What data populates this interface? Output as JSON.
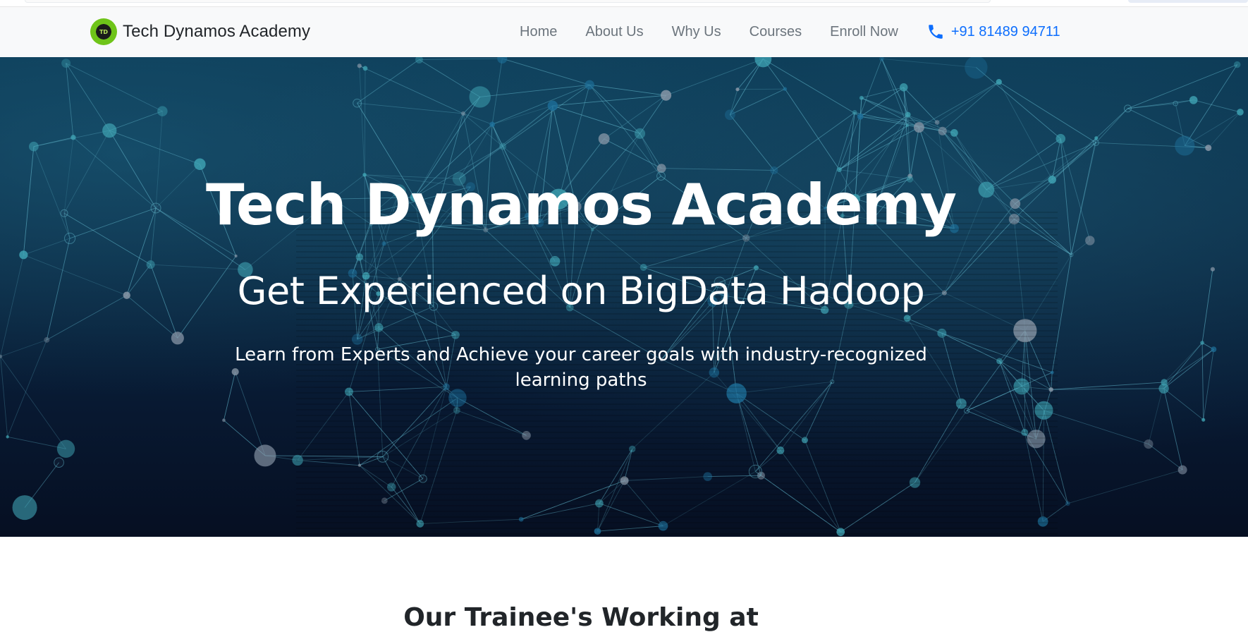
{
  "navbar": {
    "brand": {
      "logo_text": "TD",
      "name": "Tech Dynamos Academy"
    },
    "links": [
      {
        "label": "Home"
      },
      {
        "label": "About Us"
      },
      {
        "label": "Why Us"
      },
      {
        "label": "Courses"
      },
      {
        "label": "Enroll Now"
      }
    ],
    "phone": {
      "icon": "phone-icon",
      "number": "+91 81489 94711"
    }
  },
  "hero": {
    "title": "Tech Dynamos Academy",
    "subtitle": "Get Experienced on BigData Hadoop",
    "description": "Learn from Experts and Achieve your career goals with industry-recognized learning paths"
  },
  "sections": {
    "trainees_heading": "Our Trainee's Working at"
  },
  "colors": {
    "navbar_bg": "#f8f9fa",
    "nav_link": "#6c757d",
    "phone_link": "#0d6efd",
    "hero_dark": "#081a33",
    "network_line": "#5fb3c8"
  }
}
